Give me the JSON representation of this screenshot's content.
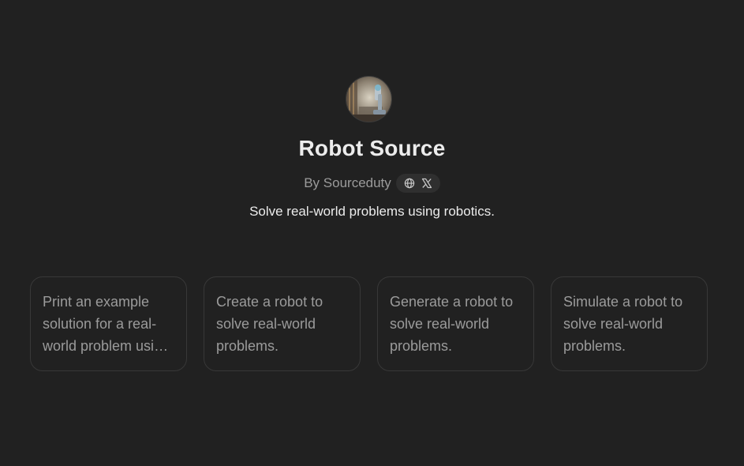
{
  "gpt": {
    "avatar_icon": "robot-arm-avatar",
    "title": "Robot Source",
    "author": "By Sourceduty",
    "social_icons": [
      "globe-icon",
      "x-logo-icon"
    ],
    "description": "Solve real-world problems using robotics."
  },
  "conversation_starters": [
    {
      "label": "Print an example solution for a real-world problem using robotics."
    },
    {
      "label": "Create a robot to solve real-world problems."
    },
    {
      "label": "Generate a robot to solve real-world problems."
    },
    {
      "label": "Simulate a robot to solve real-world problems."
    }
  ],
  "colors": {
    "background": "#212121",
    "card_border": "#383838",
    "pill_background": "#2f2f2f",
    "muted_text": "#9b9b9b",
    "primary_text": "#ececec"
  }
}
